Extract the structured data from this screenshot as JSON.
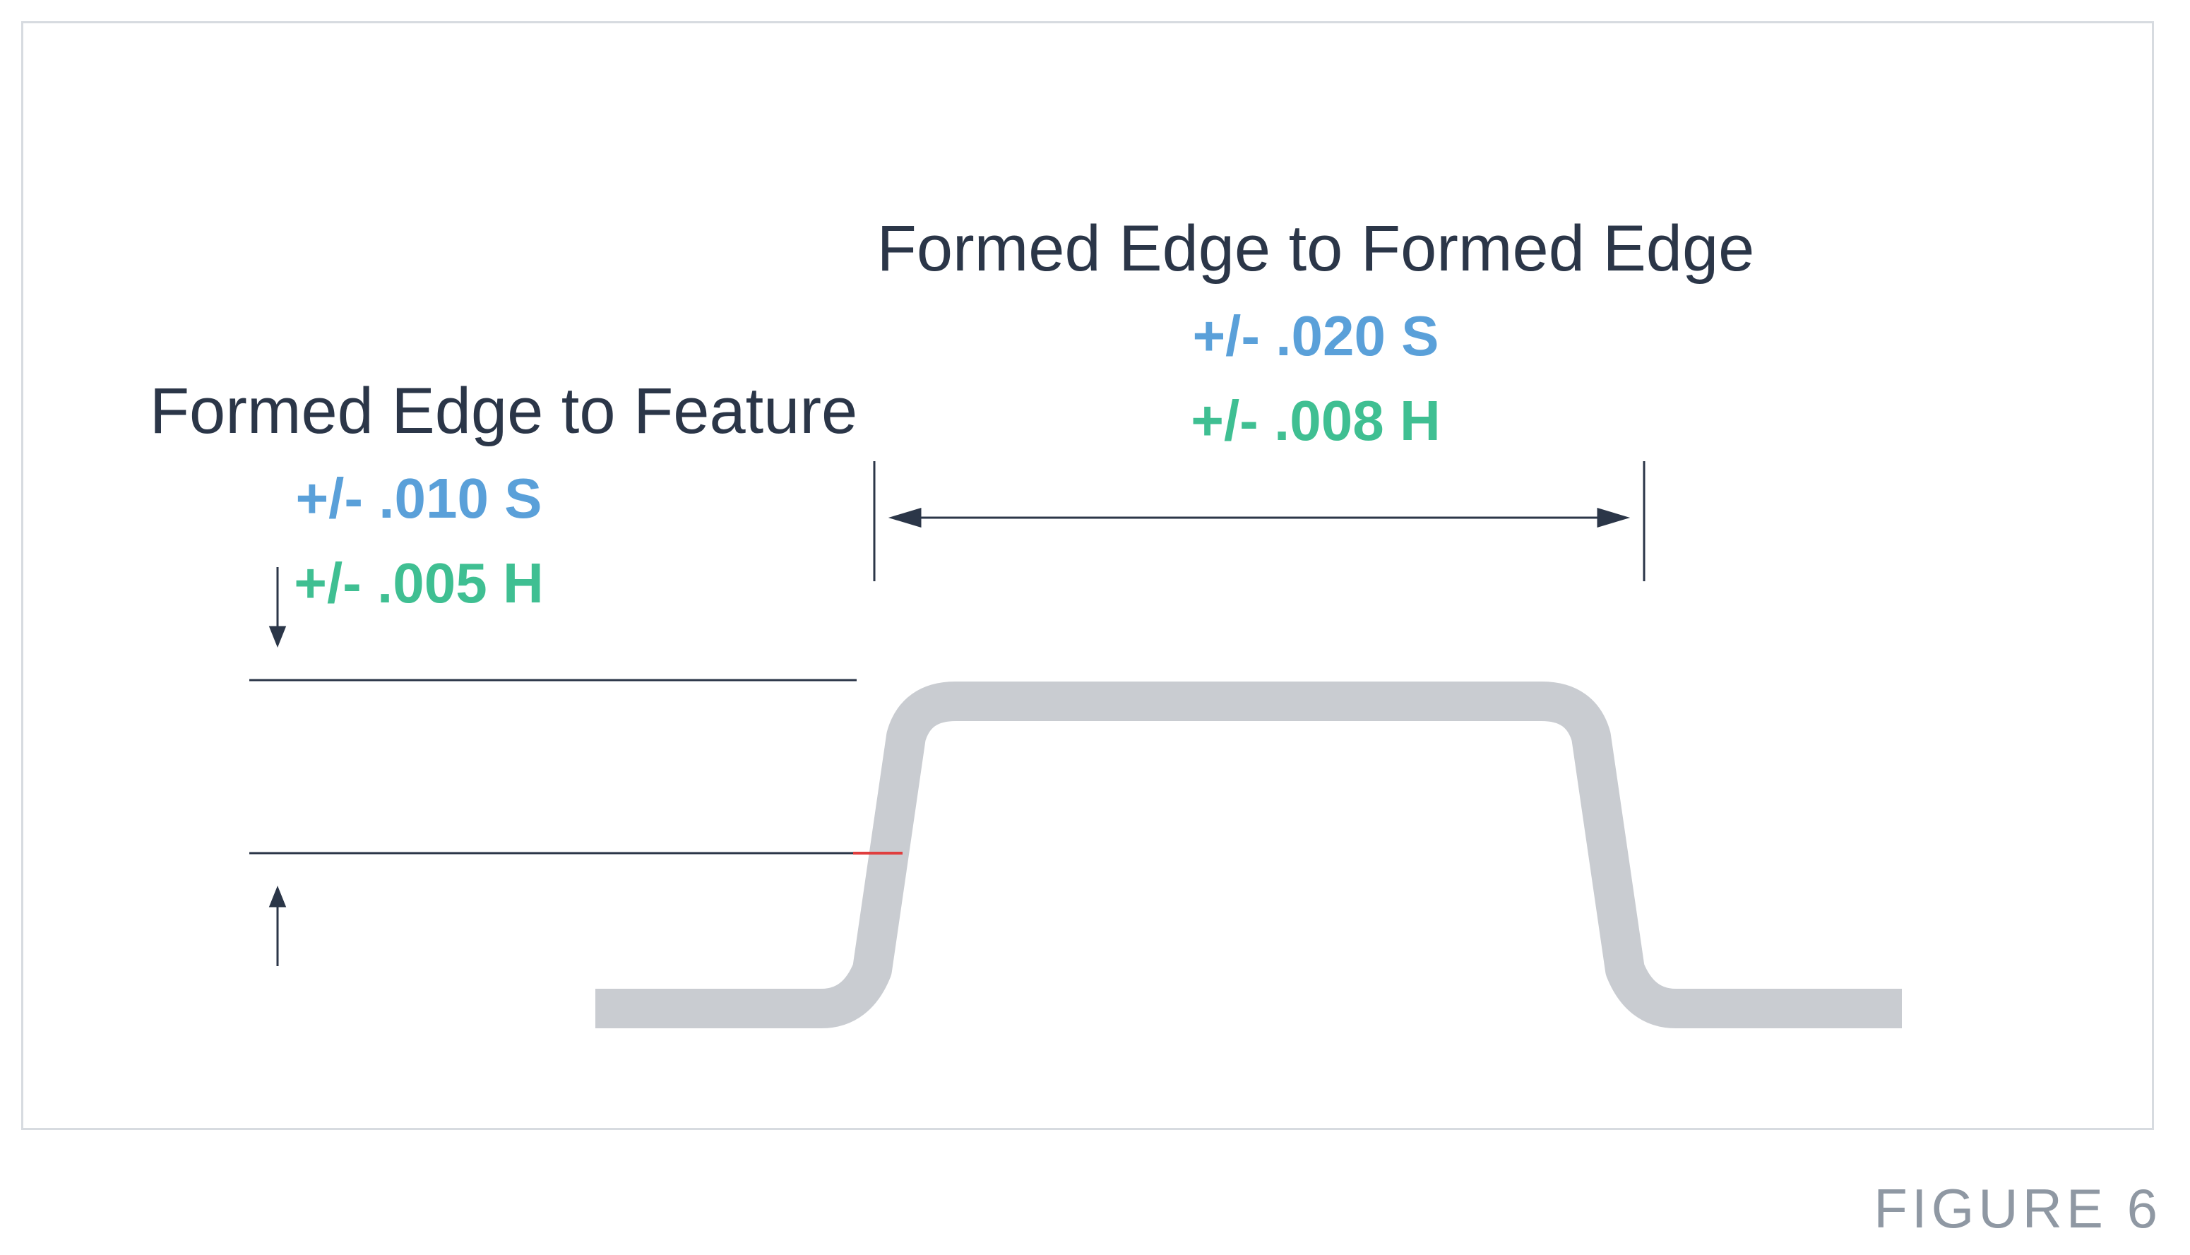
{
  "figure_label": "FIGURE 6",
  "left": {
    "title": "Formed Edge to Feature",
    "tol_s": "+/- .010 S",
    "tol_h": "+/- .005 H"
  },
  "right": {
    "title": "Formed Edge to Formed Edge",
    "tol_s": "+/- .020 S",
    "tol_h": "+/- .008 H"
  },
  "colors": {
    "title": "#2b3648",
    "blue": "#5aa0d9",
    "green": "#3fbf92",
    "profile": "#C9CCD1",
    "line": "#2b3648",
    "red": "#E03E3E"
  }
}
